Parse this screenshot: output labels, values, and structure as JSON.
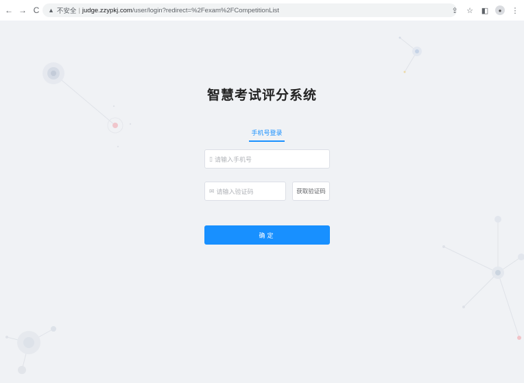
{
  "browser": {
    "back_icon": "←",
    "forward_icon": "→",
    "reload_icon": "C",
    "warning_icon": "▲",
    "insecure_label": "不安全",
    "separator": "|",
    "host": "judge.zzypkj.com",
    "path": "/user/login?redirect=%2Fexam%2FCompetitionList",
    "share_icon": "⇪",
    "star_icon": "☆",
    "sidepanel_icon": "◧",
    "menu_icon": "⋮"
  },
  "login": {
    "title": "智慧考试评分系统",
    "tab_label": "手机号登录",
    "phone_placeholder": "请输入手机号",
    "code_placeholder": "请输入验证码",
    "get_code_label": "获取验证码",
    "submit_label": "确定"
  },
  "colors": {
    "accent": "#1890ff",
    "background": "#f0f2f5"
  }
}
